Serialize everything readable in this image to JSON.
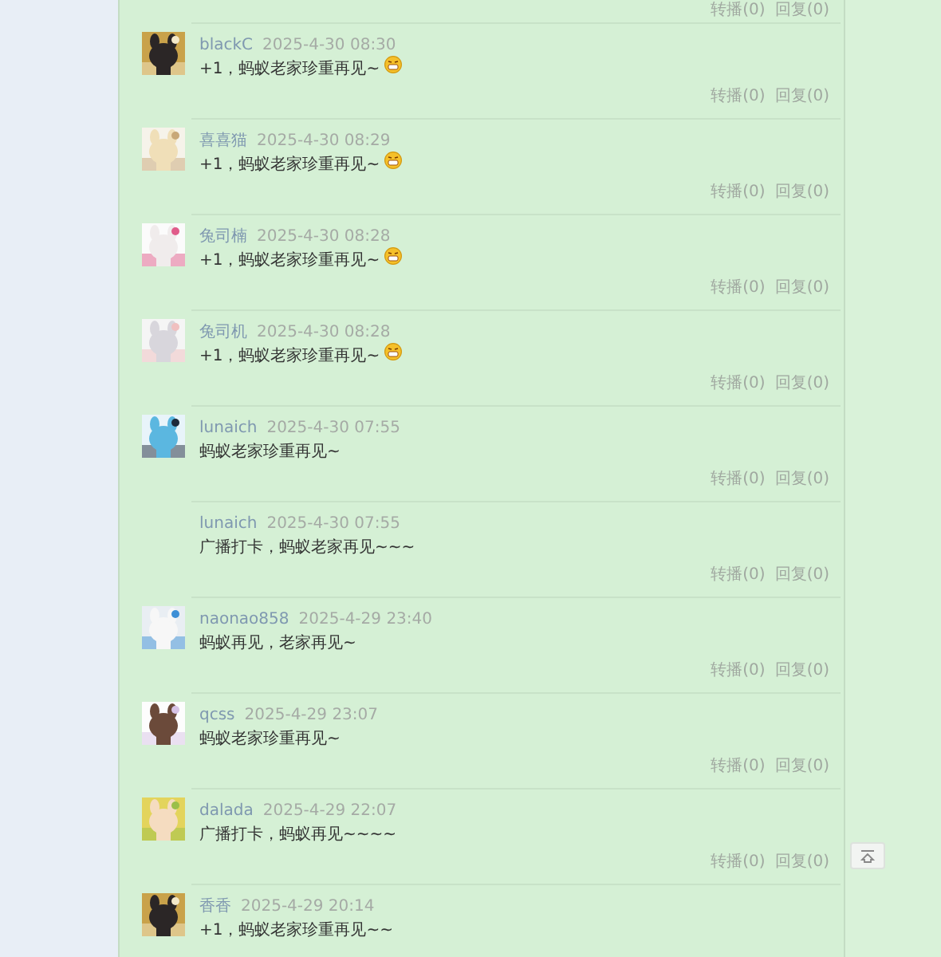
{
  "top_actions": {
    "repost": "转播(0)",
    "reply": "回复(0)"
  },
  "posts": [
    {
      "author": "blackC",
      "time": "2025-4-30 08:30",
      "text": "+1，蚂蚁老家珍重再见~",
      "emoji": true,
      "repost": "转播(0)",
      "reply": "回复(0)"
    },
    {
      "author": "喜喜猫",
      "time": "2025-4-30 08:29",
      "text": "+1，蚂蚁老家珍重再见~",
      "emoji": true,
      "repost": "转播(0)",
      "reply": "回复(0)"
    },
    {
      "author": "兔司楠",
      "time": "2025-4-30 08:28",
      "text": "+1，蚂蚁老家珍重再见~",
      "emoji": true,
      "repost": "转播(0)",
      "reply": "回复(0)"
    },
    {
      "author": "兔司机",
      "time": "2025-4-30 08:28",
      "text": "+1，蚂蚁老家珍重再见~",
      "emoji": true,
      "repost": "转播(0)",
      "reply": "回复(0)"
    },
    {
      "author": "lunaich",
      "time": "2025-4-30 07:55",
      "text": "蚂蚁老家珍重再见~",
      "emoji": false,
      "repost": "转播(0)",
      "reply": "回复(0)"
    },
    {
      "author": "lunaich",
      "time": "2025-4-30 07:55",
      "text": "广播打卡，蚂蚁老家再见~~~",
      "emoji": false,
      "repost": "转播(0)",
      "reply": "回复(0)"
    },
    {
      "author": "naonao858",
      "time": "2025-4-29 23:40",
      "text": "蚂蚁再见，老家再见~",
      "emoji": false,
      "repost": "转播(0)",
      "reply": "回复(0)"
    },
    {
      "author": "qcss",
      "time": "2025-4-29 23:07",
      "text": "蚂蚁老家珍重再见~",
      "emoji": false,
      "repost": "转播(0)",
      "reply": "回复(0)"
    },
    {
      "author": "dalada",
      "time": "2025-4-29 22:07",
      "text": "广播打卡，蚂蚁再见~~~~",
      "emoji": false,
      "repost": "转播(0)",
      "reply": "回复(0)"
    },
    {
      "author": "香香",
      "time": "2025-4-29 20:14",
      "text": "+1，蚂蚁老家珍重再见~~",
      "emoji": false
    }
  ]
}
